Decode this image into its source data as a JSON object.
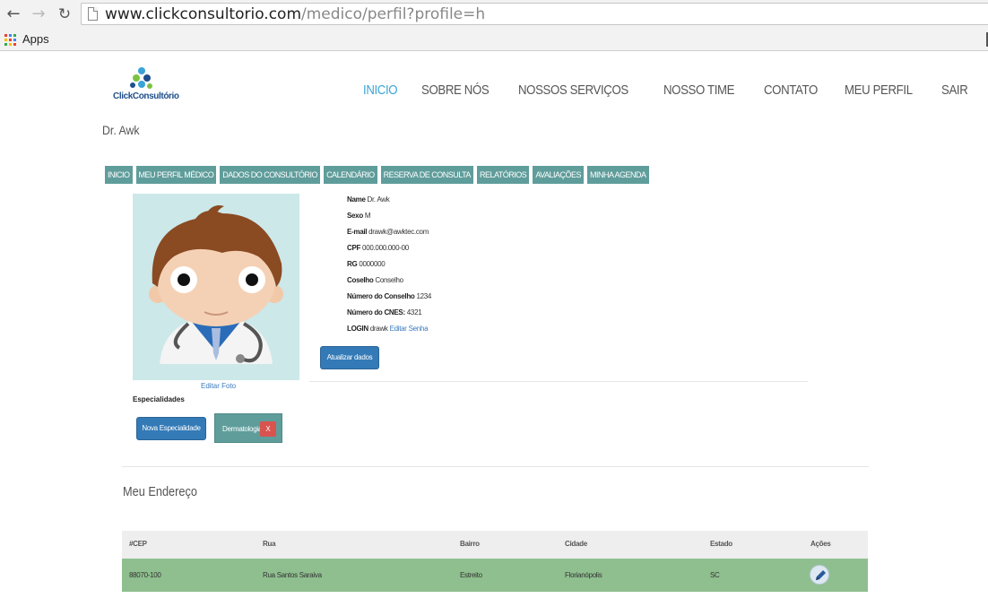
{
  "browser": {
    "url_domain": "www.clickconsultorio.com",
    "url_path": "/medico/perfil?profile=h",
    "bookmark_apps": "Apps",
    "apps_colors": [
      "#e94235",
      "#4285f4",
      "#34a853",
      "#fbbc05",
      "#e94235",
      "#4285f4",
      "#34a853",
      "#fbbc05",
      "#e94235"
    ]
  },
  "site": {
    "logo_text": "ClickConsultório",
    "nav": [
      {
        "label": "INICIO",
        "active": true
      },
      {
        "label": "SOBRE NÓS"
      },
      {
        "label": "NOSSOS SERVIÇOS"
      },
      {
        "label": "NOSSO TIME"
      },
      {
        "label": "CONTATO"
      },
      {
        "label": "MEU PERFIL"
      },
      {
        "label": "SAIR"
      }
    ],
    "accent_color": "#3aa3d8"
  },
  "doctor_name": "Dr. Awk",
  "sub_nav": [
    "INICIO",
    "MEU PERFIL MÉDICO",
    "DADOS DO CONSULTÓRIO",
    "CALENDÁRIO",
    "RESERVA DE CONSULTA",
    "RELATÓRIOS",
    "AVALIAÇÕES",
    "MINHA AGENDA"
  ],
  "profile": {
    "edit_photo": "Editar Foto",
    "especialidades_label": "Especialidades",
    "nova_especialidade": "Nova Especialidade",
    "especialidade": "Dermatologia",
    "remove_label": "X",
    "fields": [
      {
        "label": "Name",
        "value": "Dr. Awk"
      },
      {
        "label": "Sexo",
        "value": "M"
      },
      {
        "label": "E-mail",
        "value": "drawk@awktec.com"
      },
      {
        "label": "CPF",
        "value": "000.000.000-00"
      },
      {
        "label": "RG",
        "value": "0000000"
      },
      {
        "label": "Coselho",
        "value": "Conselho"
      },
      {
        "label": "Número do Conselho",
        "value": "1234"
      },
      {
        "label": "Número do CNES:",
        "value": "4321"
      },
      {
        "label": "LOGIN",
        "value": "drawk",
        "link": "Editar Senha"
      }
    ],
    "update_button": "Atualizar dados"
  },
  "address": {
    "title": "Meu Endereço",
    "columns": [
      "#CEP",
      "Rua",
      "Bairro",
      "Cidade",
      "Estado",
      "Ações"
    ],
    "rows": [
      {
        "cep": "88070-100",
        "rua": "Rua Santos Saraiva",
        "bairro": "Estreito",
        "cidade": "Florianópolis",
        "estado": "SC",
        "action_icon": "pencil-icon"
      }
    ]
  }
}
